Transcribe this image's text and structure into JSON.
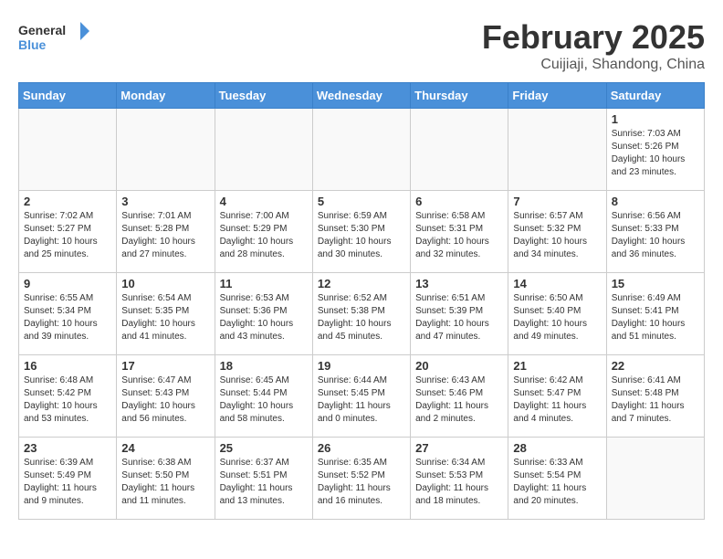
{
  "header": {
    "logo_line1": "General",
    "logo_line2": "Blue",
    "title": "February 2025",
    "subtitle": "Cuijiaji, Shandong, China"
  },
  "weekdays": [
    "Sunday",
    "Monday",
    "Tuesday",
    "Wednesday",
    "Thursday",
    "Friday",
    "Saturday"
  ],
  "weeks": [
    [
      {
        "day": "",
        "info": ""
      },
      {
        "day": "",
        "info": ""
      },
      {
        "day": "",
        "info": ""
      },
      {
        "day": "",
        "info": ""
      },
      {
        "day": "",
        "info": ""
      },
      {
        "day": "",
        "info": ""
      },
      {
        "day": "1",
        "info": "Sunrise: 7:03 AM\nSunset: 5:26 PM\nDaylight: 10 hours\nand 23 minutes."
      }
    ],
    [
      {
        "day": "2",
        "info": "Sunrise: 7:02 AM\nSunset: 5:27 PM\nDaylight: 10 hours\nand 25 minutes."
      },
      {
        "day": "3",
        "info": "Sunrise: 7:01 AM\nSunset: 5:28 PM\nDaylight: 10 hours\nand 27 minutes."
      },
      {
        "day": "4",
        "info": "Sunrise: 7:00 AM\nSunset: 5:29 PM\nDaylight: 10 hours\nand 28 minutes."
      },
      {
        "day": "5",
        "info": "Sunrise: 6:59 AM\nSunset: 5:30 PM\nDaylight: 10 hours\nand 30 minutes."
      },
      {
        "day": "6",
        "info": "Sunrise: 6:58 AM\nSunset: 5:31 PM\nDaylight: 10 hours\nand 32 minutes."
      },
      {
        "day": "7",
        "info": "Sunrise: 6:57 AM\nSunset: 5:32 PM\nDaylight: 10 hours\nand 34 minutes."
      },
      {
        "day": "8",
        "info": "Sunrise: 6:56 AM\nSunset: 5:33 PM\nDaylight: 10 hours\nand 36 minutes."
      }
    ],
    [
      {
        "day": "9",
        "info": "Sunrise: 6:55 AM\nSunset: 5:34 PM\nDaylight: 10 hours\nand 39 minutes."
      },
      {
        "day": "10",
        "info": "Sunrise: 6:54 AM\nSunset: 5:35 PM\nDaylight: 10 hours\nand 41 minutes."
      },
      {
        "day": "11",
        "info": "Sunrise: 6:53 AM\nSunset: 5:36 PM\nDaylight: 10 hours\nand 43 minutes."
      },
      {
        "day": "12",
        "info": "Sunrise: 6:52 AM\nSunset: 5:38 PM\nDaylight: 10 hours\nand 45 minutes."
      },
      {
        "day": "13",
        "info": "Sunrise: 6:51 AM\nSunset: 5:39 PM\nDaylight: 10 hours\nand 47 minutes."
      },
      {
        "day": "14",
        "info": "Sunrise: 6:50 AM\nSunset: 5:40 PM\nDaylight: 10 hours\nand 49 minutes."
      },
      {
        "day": "15",
        "info": "Sunrise: 6:49 AM\nSunset: 5:41 PM\nDaylight: 10 hours\nand 51 minutes."
      }
    ],
    [
      {
        "day": "16",
        "info": "Sunrise: 6:48 AM\nSunset: 5:42 PM\nDaylight: 10 hours\nand 53 minutes."
      },
      {
        "day": "17",
        "info": "Sunrise: 6:47 AM\nSunset: 5:43 PM\nDaylight: 10 hours\nand 56 minutes."
      },
      {
        "day": "18",
        "info": "Sunrise: 6:45 AM\nSunset: 5:44 PM\nDaylight: 10 hours\nand 58 minutes."
      },
      {
        "day": "19",
        "info": "Sunrise: 6:44 AM\nSunset: 5:45 PM\nDaylight: 11 hours\nand 0 minutes."
      },
      {
        "day": "20",
        "info": "Sunrise: 6:43 AM\nSunset: 5:46 PM\nDaylight: 11 hours\nand 2 minutes."
      },
      {
        "day": "21",
        "info": "Sunrise: 6:42 AM\nSunset: 5:47 PM\nDaylight: 11 hours\nand 4 minutes."
      },
      {
        "day": "22",
        "info": "Sunrise: 6:41 AM\nSunset: 5:48 PM\nDaylight: 11 hours\nand 7 minutes."
      }
    ],
    [
      {
        "day": "23",
        "info": "Sunrise: 6:39 AM\nSunset: 5:49 PM\nDaylight: 11 hours\nand 9 minutes."
      },
      {
        "day": "24",
        "info": "Sunrise: 6:38 AM\nSunset: 5:50 PM\nDaylight: 11 hours\nand 11 minutes."
      },
      {
        "day": "25",
        "info": "Sunrise: 6:37 AM\nSunset: 5:51 PM\nDaylight: 11 hours\nand 13 minutes."
      },
      {
        "day": "26",
        "info": "Sunrise: 6:35 AM\nSunset: 5:52 PM\nDaylight: 11 hours\nand 16 minutes."
      },
      {
        "day": "27",
        "info": "Sunrise: 6:34 AM\nSunset: 5:53 PM\nDaylight: 11 hours\nand 18 minutes."
      },
      {
        "day": "28",
        "info": "Sunrise: 6:33 AM\nSunset: 5:54 PM\nDaylight: 11 hours\nand 20 minutes."
      },
      {
        "day": "",
        "info": ""
      }
    ]
  ]
}
